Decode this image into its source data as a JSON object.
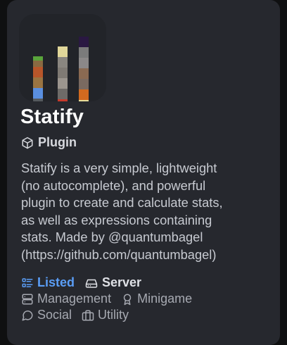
{
  "project": {
    "name": "Statify",
    "type_label": "Plugin",
    "description_lines": [
      "Statify is a very simple, lightweight",
      "(no autocomplete), and powerful",
      "plugin to create and calculate stats,",
      "as well as expressions containing",
      "stats. Made by @quantumbagel",
      "(https://github.com/quantumbagel)"
    ]
  },
  "tags": {
    "status": "Listed",
    "environment": "Server",
    "categories": [
      "Management",
      "Minigame",
      "Social",
      "Utility"
    ]
  },
  "icons": {
    "type": "box-icon",
    "status": "list-icon",
    "environment": "server-icon",
    "management": "database-icon",
    "minigame": "award-icon",
    "social": "message-circle-icon",
    "utility": "briefcase-icon"
  },
  "colors": {
    "background": "#0f1011",
    "card": "#26282e",
    "listed": "#5a9df5",
    "title": "#ffffff",
    "text": "#c7cad1"
  }
}
